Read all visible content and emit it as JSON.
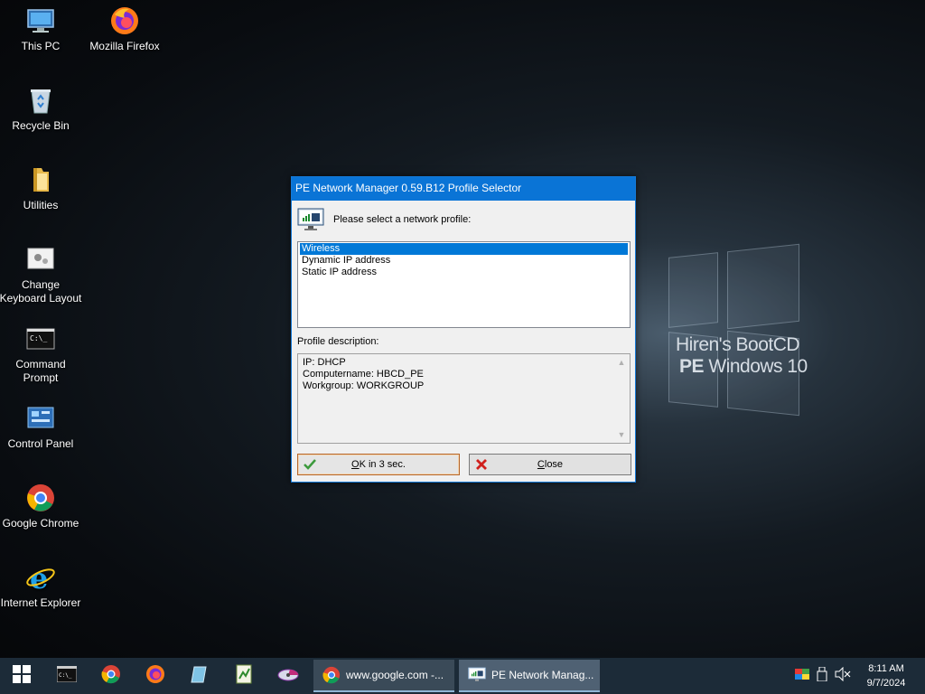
{
  "wallpaper": {
    "line1": "Hiren's BootCD",
    "line2_bold": "PE",
    "line2_rest": " Windows 10"
  },
  "desktop_icons": [
    {
      "label": "This PC",
      "icon": "computer-icon"
    },
    {
      "label": "Mozilla Firefox",
      "icon": "firefox-icon"
    },
    {
      "label": "Recycle Bin",
      "icon": "recycle-bin-icon"
    },
    {
      "label": "Utilities",
      "icon": "folder-icon"
    },
    {
      "label": "Change\nKeyboard Layout",
      "icon": "keyboard-settings-icon"
    },
    {
      "label": "Command\nPrompt",
      "icon": "command-prompt-icon"
    },
    {
      "label": "Control Panel",
      "icon": "control-panel-icon"
    },
    {
      "label": "Google Chrome",
      "icon": "chrome-icon"
    },
    {
      "label": "Internet Explorer",
      "icon": "internet-explorer-icon"
    }
  ],
  "dialog": {
    "title": "PE Network Manager 0.59.B12 Profile Selector",
    "prompt": "Please select a network profile:",
    "profiles": [
      "Wireless",
      "Dynamic IP address",
      "Static IP address"
    ],
    "selected_profile": "Wireless",
    "description_label": "Profile description:",
    "description_lines": [
      "IP: DHCP",
      "Computername: HBCD_PE",
      "Workgroup: WORKGROUP"
    ],
    "ok_button": {
      "mnemonic": "O",
      "rest": "K in 3 sec."
    },
    "close_button": {
      "mnemonic": "C",
      "rest": "lose"
    }
  },
  "taskbar": {
    "pinned": [
      "start-icon",
      "command-prompt-icon",
      "chrome-icon",
      "firefox-icon",
      "tool-icon",
      "spreadsheet-icon",
      "partition-icon"
    ],
    "tasks": [
      {
        "label": "www.google.com -...",
        "icon": "chrome-icon",
        "active": false
      },
      {
        "label": "PE Network Manag...",
        "icon": "network-manager-icon",
        "active": true
      }
    ],
    "clock": {
      "time": "8:11 AM",
      "date": "9/7/2024"
    }
  },
  "colors": {
    "title_bar": "#0a74d6",
    "selection": "#0078d7",
    "taskbar": "#1c2b38"
  }
}
